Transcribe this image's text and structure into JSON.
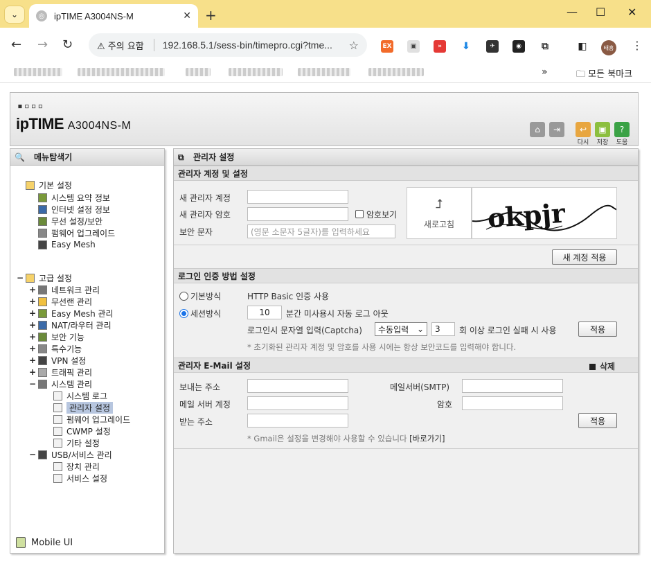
{
  "browser": {
    "tab_title": "ipTIME A3004NS-M",
    "tab_close": "✕",
    "new_tab": "+",
    "security_label": "⚠ 주의 요함",
    "url": "192.168.5.1/sess-bin/timepro.cgi?tme...",
    "avatar_text": "태흥",
    "bookmarks_more": "»",
    "all_bookmarks": "모든 북마크",
    "ext_colors": [
      "#f26b2a",
      "#e0e0e0",
      "#e53935",
      "#1e88e5",
      "#333333",
      "#222222",
      "#555555"
    ]
  },
  "router": {
    "logo_dots": "▪▫▫▫",
    "brand": "ipTIME",
    "model": "A3004NS-M",
    "header_buttons": [
      {
        "name": "home",
        "label": ""
      },
      {
        "name": "logout",
        "label": ""
      },
      {
        "name": "undo",
        "label": "다시"
      },
      {
        "name": "save",
        "label": "저장"
      },
      {
        "name": "help",
        "label": "도움"
      }
    ]
  },
  "left_panel": {
    "title": "메뉴탐색기",
    "tree": [
      {
        "label": "기본 설정",
        "level": 0,
        "expander": ""
      },
      {
        "label": "시스템 요약 정보",
        "level": 1,
        "expander": ""
      },
      {
        "label": "인터넷 설정 정보",
        "level": 1,
        "expander": ""
      },
      {
        "label": "무선 설정/보안",
        "level": 1,
        "expander": ""
      },
      {
        "label": "펌웨어 업그레이드",
        "level": 1,
        "expander": ""
      },
      {
        "label": "Easy Mesh",
        "level": 1,
        "expander": ""
      },
      {
        "label": "고급 설정",
        "level": 0,
        "expander": "−"
      },
      {
        "label": "네트워크 관리",
        "level": 1,
        "expander": "+"
      },
      {
        "label": "무선랜 관리",
        "level": 1,
        "expander": "+"
      },
      {
        "label": "Easy Mesh 관리",
        "level": 1,
        "expander": "+"
      },
      {
        "label": "NAT/라우터 관리",
        "level": 1,
        "expander": "+"
      },
      {
        "label": "보안 기능",
        "level": 1,
        "expander": "+"
      },
      {
        "label": "특수기능",
        "level": 1,
        "expander": "+"
      },
      {
        "label": "VPN 설정",
        "level": 1,
        "expander": "+"
      },
      {
        "label": "트래픽 관리",
        "level": 1,
        "expander": "+"
      },
      {
        "label": "시스템 관리",
        "level": 1,
        "expander": "−"
      },
      {
        "label": "시스템 로그",
        "level": 2,
        "expander": ""
      },
      {
        "label": "관리자 설정",
        "level": 2,
        "expander": "",
        "selected": true
      },
      {
        "label": "펌웨어 업그레이드",
        "level": 2,
        "expander": ""
      },
      {
        "label": "CWMP 설정",
        "level": 2,
        "expander": ""
      },
      {
        "label": "기타 설정",
        "level": 2,
        "expander": ""
      },
      {
        "label": "USB/서비스 관리",
        "level": 1,
        "expander": "−"
      },
      {
        "label": "장치 관리",
        "level": 2,
        "expander": ""
      },
      {
        "label": "서비스 설정",
        "level": 2,
        "expander": ""
      }
    ],
    "mobile_ui": "Mobile UI"
  },
  "main": {
    "title": "관리자 설정",
    "account_section": {
      "title": "관리자 계정 및 설정",
      "new_admin_id_label": "새 관리자 계정",
      "new_admin_id_value": "",
      "new_admin_pw_label": "새 관리자 암호",
      "new_admin_pw_value": "",
      "show_pw_label": "암호보기",
      "security_text_label": "보안 문자",
      "security_text_placeholder": "(영문 소문자 5글자)를 입력하세요",
      "refresh_label": "새로고침",
      "captcha_text": "okpjr",
      "apply_label": "새 계정 적용"
    },
    "login_section": {
      "title": "로그인 인증 방법 설정",
      "basic_label": "기본방식",
      "basic_desc": "HTTP Basic 인증 사용",
      "session_label": "세션방식",
      "timeout_value": "10",
      "timeout_desc": "분간 미사용시 자동 로그 아웃",
      "captcha_label": "로그인시 문자열 입력(Captcha)",
      "captcha_mode": "수동입력",
      "fail_count": "3",
      "fail_desc": "회 이상 로그인 실패 시 사용",
      "apply_label": "적용",
      "note": "* 초기화된 관리자 계정 및 암호를 사용 시에는 항상 보안코드를 입력해야 합니다."
    },
    "email_section": {
      "title": "관리자 E-Mail 설정",
      "delete_label": "삭제",
      "sender_label": "보내는 주소",
      "sender_value": "",
      "smtp_label": "메일서버(SMTP)",
      "smtp_value": "",
      "account_label": "메일 서버 계정",
      "account_value": "",
      "password_label": "암호",
      "password_value": "",
      "receiver_label": "받는 주소",
      "receiver_value": "",
      "apply_label": "적용",
      "note": "* Gmail은 설정을 변경해야 사용할 수 있습니다",
      "goto_link": "[바로가기]"
    }
  }
}
